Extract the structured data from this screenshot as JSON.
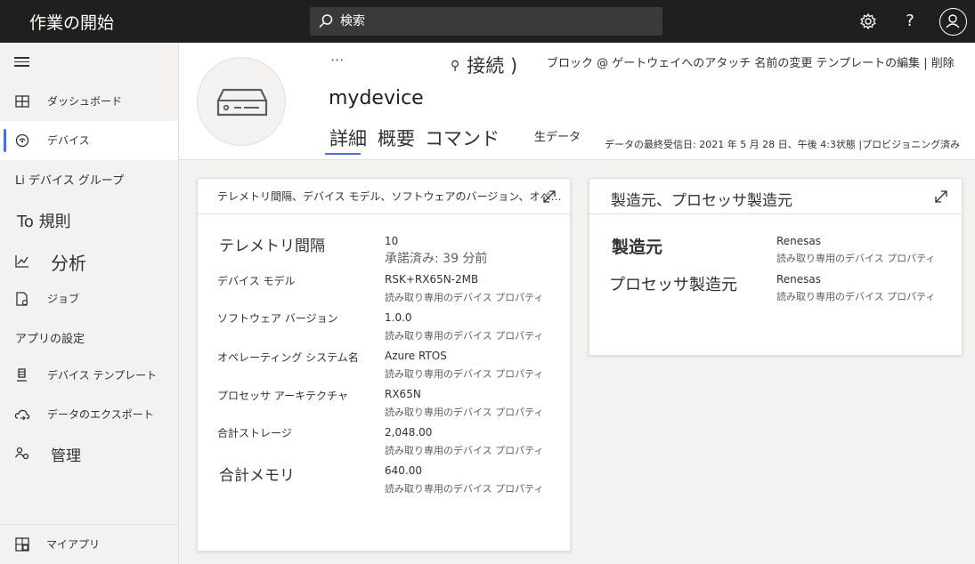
{
  "topbar": {
    "app_title": "作業の開始",
    "search_placeholder": "検索",
    "settings_icon": "gear-icon",
    "help_label": "?",
    "avatar_icon": "user-icon"
  },
  "sidebar": {
    "items": [
      {
        "label": "ダッシュボード"
      },
      {
        "label": "デバイス"
      },
      {
        "label": "Li デバイス グループ"
      },
      {
        "label": "To 規則"
      },
      {
        "label": "分析"
      },
      {
        "label": "ジョブ"
      },
      {
        "label": "アプリの設定"
      },
      {
        "label": "デバイス テンプレート"
      },
      {
        "label": "データのエクスポート"
      },
      {
        "label": "管理"
      }
    ],
    "bottom_label": "マイアプリ"
  },
  "header": {
    "more": "···",
    "connect": "接続 )",
    "commands": "ブロック @  ゲートウェイへのアタッチ 名前の変更 テンプレートの編集 | 削除",
    "device_name": "mydevice",
    "tabs": [
      "詳細",
      "概要",
      "コマンド"
    ],
    "raw_data_tab": "生データ",
    "last_data": "データの最終受信日: 2021 年 5 月 28 日、午後 4:3状態 |プロビジョニング済み"
  },
  "card1": {
    "title": "テレメトリ間隔、デバイス モデル、ソフトウェアのバージョン、オペ…",
    "props": [
      {
        "name": "テレメトリ間隔",
        "value": "10",
        "sub": "承諾済み: 39 分前"
      },
      {
        "name": "デバイス モデル",
        "value": "RSK+RX65N-2MB",
        "sub": "読み取り専用のデバイス プロパティ"
      },
      {
        "name": "ソフトウェア バージョン",
        "value": "1.0.0",
        "sub": "読み取り専用のデバイス プロパティ"
      },
      {
        "name": "オペレーティング システム名",
        "value": "Azure RTOS",
        "sub": "読み取り専用のデバイス プロパティ"
      },
      {
        "name": "プロセッサ アーキテクチャ",
        "value": "RX65N",
        "sub": "読み取り専用のデバイス プロパティ"
      },
      {
        "name": "合計ストレージ",
        "value": "2,048.00",
        "sub": "読み取り専用のデバイス プロパティ"
      },
      {
        "name": "合計メモリ",
        "value": "640.00",
        "sub": "読み取り専用のデバイス プロパティ"
      }
    ]
  },
  "card2": {
    "title": "製造元、プロセッサ製造元",
    "props": [
      {
        "name": "製造元",
        "value": "Renesas",
        "sub": "読み取り専用のデバイス プロパティ"
      },
      {
        "name": "プロセッサ製造元",
        "value": "Renesas",
        "sub": "読み取り専用のデバイス プロパティ"
      }
    ]
  },
  "colors": {
    "accent": "#4f6bed",
    "topbar": "#201f1e"
  }
}
